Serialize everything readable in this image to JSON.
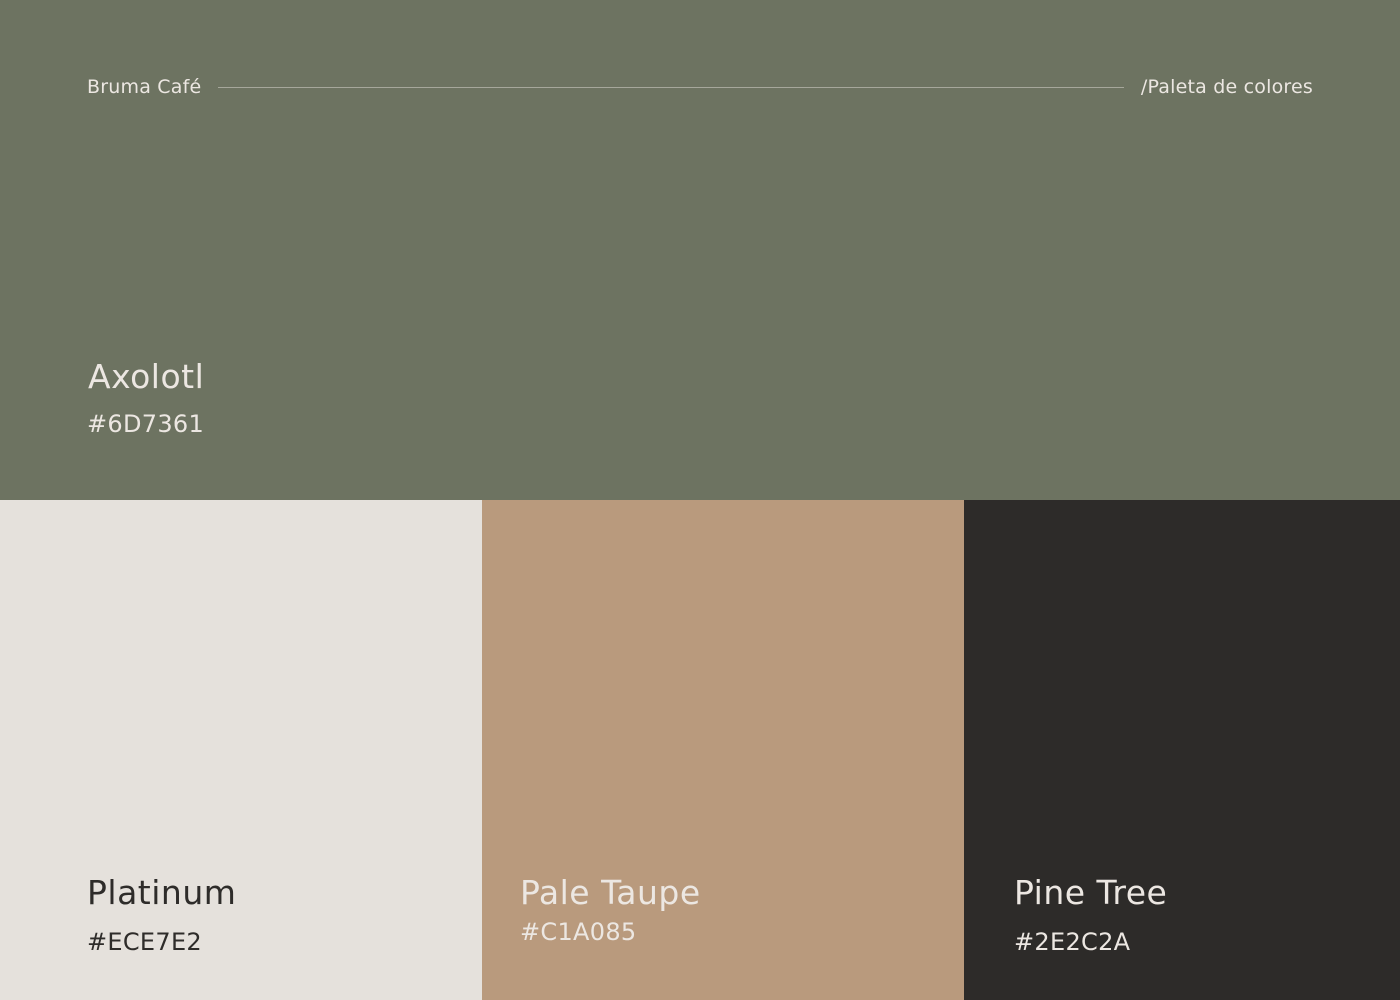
{
  "header": {
    "brand": "Bruma Café",
    "section_label": "/Paleta de colores"
  },
  "swatches": [
    {
      "name": "Axolotl",
      "hex_label": "#6D7361",
      "fill": "#6D7361",
      "text_color": "#ECE7E2"
    },
    {
      "name": "Platinum",
      "hex_label": "#ECE7E2",
      "fill": "#E5E1DC",
      "text_color": "#2E2C2A"
    },
    {
      "name": "Pale Taupe",
      "hex_label": "#C1A085",
      "fill": "#B99A7D",
      "text_color": "#ECE7E2"
    },
    {
      "name": "Pine Tree",
      "hex_label": "#2E2C2A",
      "fill": "#2D2B29",
      "text_color": "#ECE7E2"
    }
  ]
}
